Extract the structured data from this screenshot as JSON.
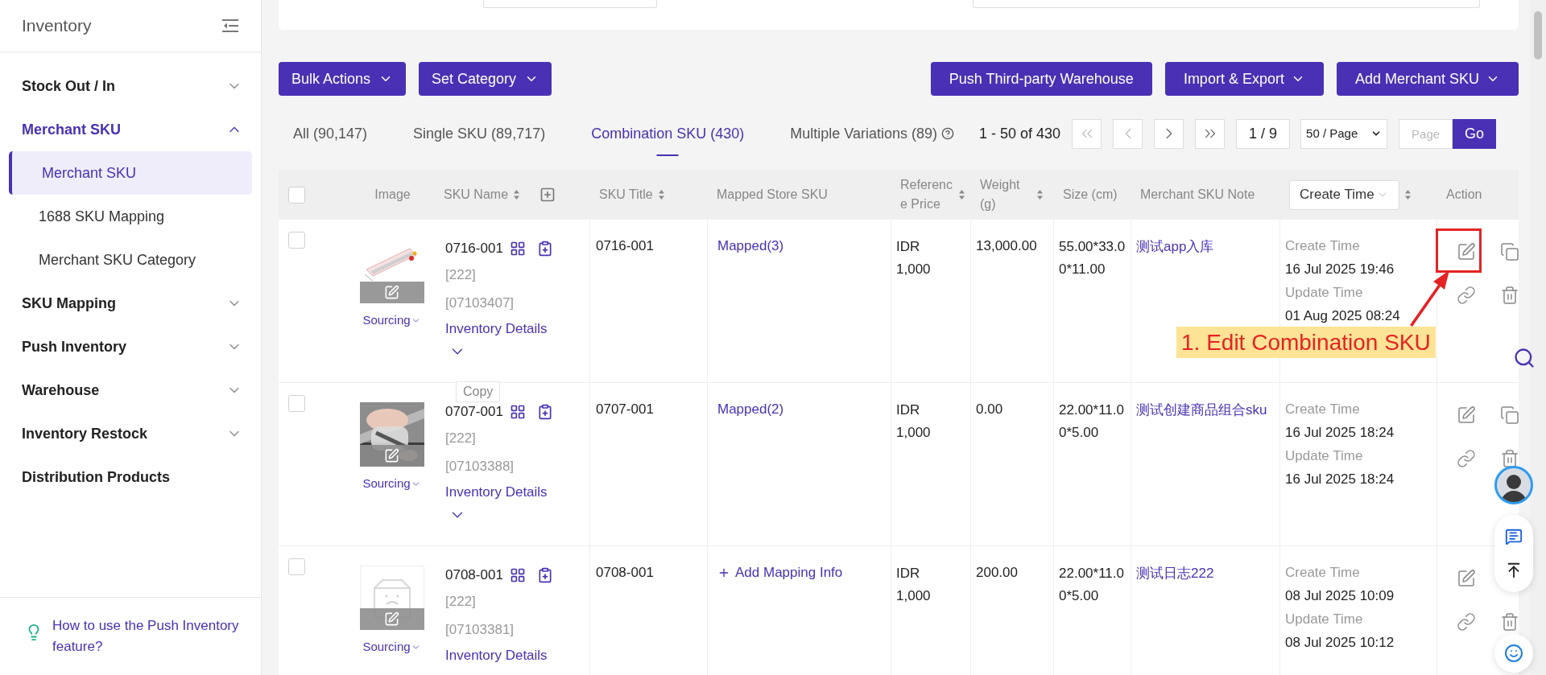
{
  "sidebar": {
    "title": "Inventory",
    "groups": [
      {
        "label": "Stock Out / In",
        "expandable": true,
        "expanded": false
      },
      {
        "label": "Merchant SKU",
        "expandable": true,
        "expanded": true,
        "children": [
          {
            "label": "Merchant SKU",
            "selected": true
          },
          {
            "label": "1688 SKU Mapping",
            "selected": false
          },
          {
            "label": "Merchant SKU Category",
            "selected": false
          }
        ]
      },
      {
        "label": "SKU Mapping",
        "expandable": true,
        "expanded": false
      },
      {
        "label": "Push Inventory",
        "expandable": true,
        "expanded": false
      },
      {
        "label": "Warehouse",
        "expandable": true,
        "expanded": false
      },
      {
        "label": "Inventory Restock",
        "expandable": true,
        "expanded": false
      },
      {
        "label": "Distribution Products",
        "expandable": false,
        "expanded": false
      }
    ],
    "help_link": "How to use the Push Inventory feature?"
  },
  "toolbar": {
    "left": [
      {
        "label": "Bulk Actions"
      },
      {
        "label": "Set Category"
      }
    ],
    "right": [
      {
        "label": "Push Third-party Warehouse",
        "dropdown": false
      },
      {
        "label": "Import & Export",
        "dropdown": true
      },
      {
        "label": "Add Merchant SKU",
        "dropdown": true
      }
    ]
  },
  "tabs": [
    {
      "label": "All (90,147)",
      "selected": false,
      "help": false
    },
    {
      "label": "Single SKU (89,717)",
      "selected": false,
      "help": false
    },
    {
      "label": "Combination SKU (430)",
      "selected": true,
      "help": false
    },
    {
      "label": "Multiple Variations (89)",
      "selected": false,
      "help": true
    }
  ],
  "pagination": {
    "range": "1 - 50 of 430",
    "page": "1 / 9",
    "page_size": "50 / Page",
    "page_placeholder": "Page",
    "go": "Go"
  },
  "table": {
    "select_all_checked": false,
    "columns": [
      {
        "label": "Image",
        "kind": "plain"
      },
      {
        "label": "SKU Name",
        "kind": "sort-add"
      },
      {
        "label": "SKU Title",
        "kind": "sort"
      },
      {
        "label": "Mapped Store SKU",
        "kind": "plain"
      },
      {
        "label": "Reference Price",
        "kind": "sort"
      },
      {
        "label": "Weight (g)",
        "kind": "sort"
      },
      {
        "label": "Size (cm)",
        "kind": "plain"
      },
      {
        "label": "Merchant SKU Note",
        "kind": "plain"
      },
      {
        "label": "Create Time",
        "kind": "sort-dropdown"
      },
      {
        "label": "Action",
        "kind": "plain"
      }
    ],
    "rows": [
      {
        "checked": false,
        "image": {
          "kind": "picture"
        },
        "sourcing": "Sourcing",
        "sku_name": "0716-001",
        "tags": [
          "[222]",
          "[07103407]"
        ],
        "inventory_details": "Inventory Details",
        "sku_title": "0716-001",
        "mapping": {
          "kind": "mapped",
          "text": "Mapped(3)"
        },
        "reference_price": [
          "IDR",
          "1,000"
        ],
        "weight": "13,000.00",
        "size": "55.00*33.00*11.00",
        "note": "测试app入库",
        "create_label": "Create Time",
        "create_time": "16 Jul 2025 19:46",
        "update_label": "Update Time",
        "update_time": "01 Aug 2025 08:24"
      },
      {
        "checked": false,
        "image": {
          "kind": "picture"
        },
        "sourcing": "Sourcing",
        "sku_name": "0707-001",
        "tags": [
          "[222]",
          "[07103388]"
        ],
        "inventory_details": "Inventory Details",
        "sku_title": "0707-001",
        "mapping": {
          "kind": "mapped",
          "text": "Mapped(2)"
        },
        "reference_price": [
          "IDR",
          "1,000"
        ],
        "weight": "0.00",
        "size": "22.00*11.00*5.00",
        "note": "测试创建商品组合sku",
        "create_label": "Create Time",
        "create_time": "16 Jul 2025 18:24",
        "update_label": "Update Time",
        "update_time": "16 Jul 2025 18:24"
      },
      {
        "checked": false,
        "image": {
          "kind": "placeholder"
        },
        "sourcing": "Sourcing",
        "sku_name": "0708-001",
        "tags": [
          "[222]",
          "[07103381]"
        ],
        "inventory_details": "Inventory Details",
        "sku_title": "0708-001",
        "mapping": {
          "kind": "add",
          "text": "Add Mapping Info"
        },
        "reference_price": [
          "IDR",
          "1,000"
        ],
        "weight": "200.00",
        "size": "22.00*11.00*5.00",
        "note": "测试日志222",
        "create_label": "Create Time",
        "create_time": "08 Jul 2025 10:09",
        "update_label": "Update Time",
        "update_time": "08 Jul 2025 10:12"
      }
    ]
  },
  "tooltip": {
    "text": "Copy"
  },
  "annotation": {
    "text": "1. Edit Combination SKU"
  }
}
